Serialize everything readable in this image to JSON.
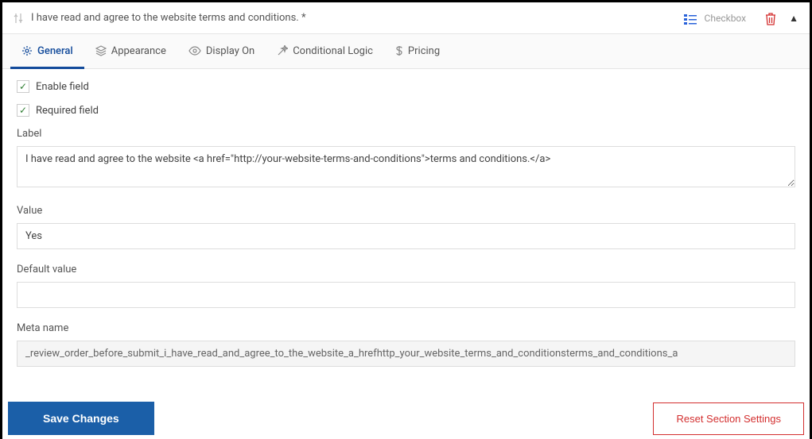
{
  "header": {
    "title": "I have read and agree to the website terms and conditions. *",
    "type_label": "Checkbox"
  },
  "tabs": {
    "general": "General",
    "appearance": "Appearance",
    "display_on": "Display On",
    "conditional_logic": "Conditional Logic",
    "pricing": "Pricing"
  },
  "form": {
    "enable_field": "Enable field",
    "required_field": "Required field",
    "label_caption": "Label",
    "label_value": "I have read and agree to the website <a href=\"http://your-website-terms-and-conditions\">terms and conditions.</a>",
    "value_caption": "Value",
    "value_value": "Yes",
    "default_caption": "Default value",
    "default_value": "",
    "meta_caption": "Meta name",
    "meta_value": "_review_order_before_submit_i_have_read_and_agree_to_the_website_a_hrefhttp_your_website_terms_and_conditionsterms_and_conditions_a"
  },
  "footer": {
    "save": "Save Changes",
    "reset": "Reset Section Settings"
  }
}
